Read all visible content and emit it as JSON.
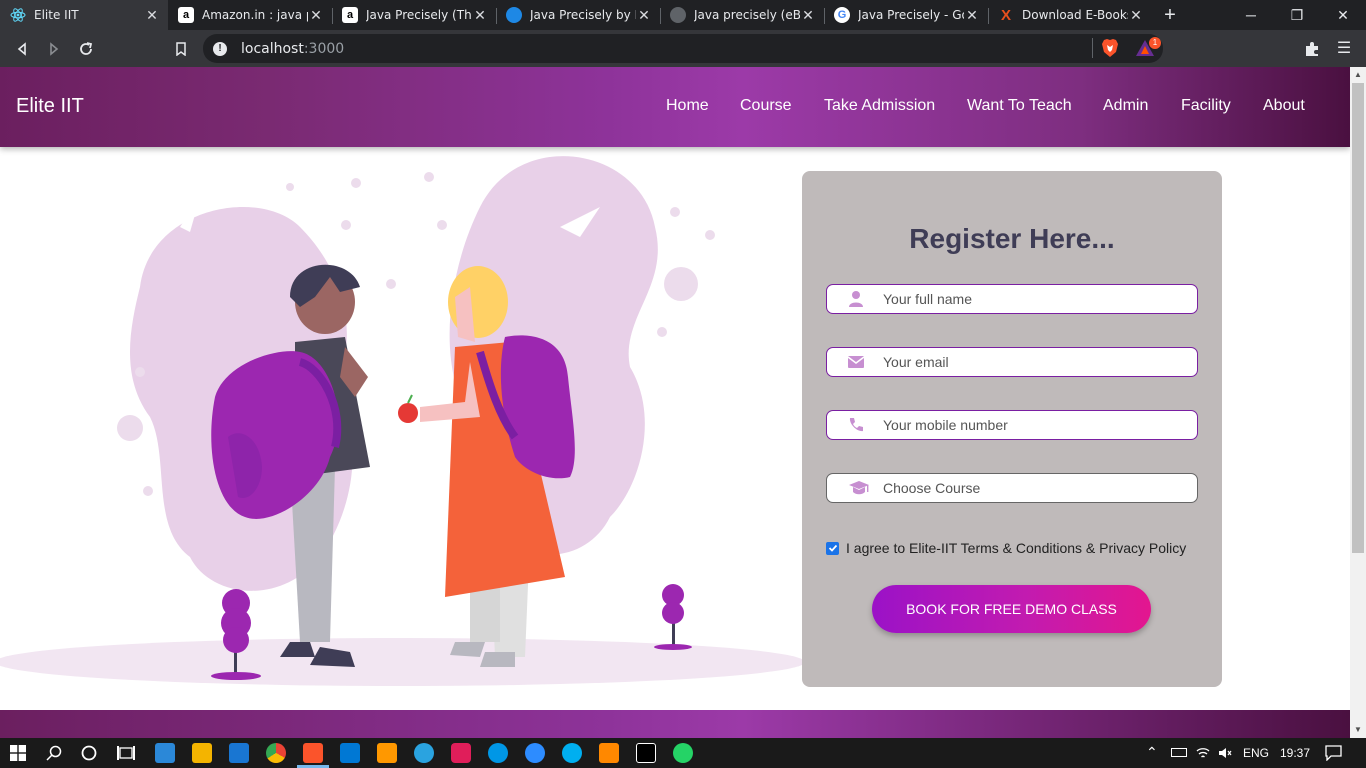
{
  "browser": {
    "tabs": [
      {
        "title": "Elite IIT",
        "icon": "react-icon",
        "active": true
      },
      {
        "title": "Amazon.in : java pre",
        "icon": "amazon-icon",
        "active": false
      },
      {
        "title": "Java Precisely (The M",
        "icon": "amazon-icon",
        "active": false
      },
      {
        "title": "Java Precisely by Pet",
        "icon": "globe-icon",
        "active": false
      },
      {
        "title": "Java precisely (eBoo",
        "icon": "globe-icon",
        "active": false
      },
      {
        "title": "Java Precisely - Goo",
        "icon": "google-icon",
        "active": false
      },
      {
        "title": "Download E-Books",
        "icon": "x-icon",
        "active": false
      }
    ],
    "url_host": "localhost",
    "url_port": ":3000",
    "shields_badge": "1"
  },
  "site": {
    "brand": "Elite IIT",
    "nav": [
      "Home",
      "Course",
      "Take Admission",
      "Want To Teach",
      "Admin",
      "Facility",
      "About"
    ]
  },
  "register": {
    "title": "Register Here...",
    "fields": [
      {
        "placeholder": "Your full name",
        "icon": "user-icon"
      },
      {
        "placeholder": "Your email",
        "icon": "envelope-icon"
      },
      {
        "placeholder": "Your mobile number",
        "icon": "phone-icon"
      },
      {
        "placeholder": "Choose Course",
        "icon": "graduation-cap-icon"
      }
    ],
    "agree_checked": true,
    "agree_label": "I agree to Elite-IIT Terms & Conditions & Privacy Policy",
    "submit_label": "BOOK FOR FREE DEMO CLASS"
  },
  "colors": {
    "nav_gradient": [
      "#6b1f5f",
      "#9c3aa8",
      "#4a1040"
    ],
    "card_bg": "#bfbaba",
    "title": "#3f3d56",
    "field_border": "#7a1fa2",
    "button": [
      "#9b12c7",
      "#e3168f"
    ]
  },
  "taskbar": {
    "language": "ENG",
    "time": "19:37"
  }
}
